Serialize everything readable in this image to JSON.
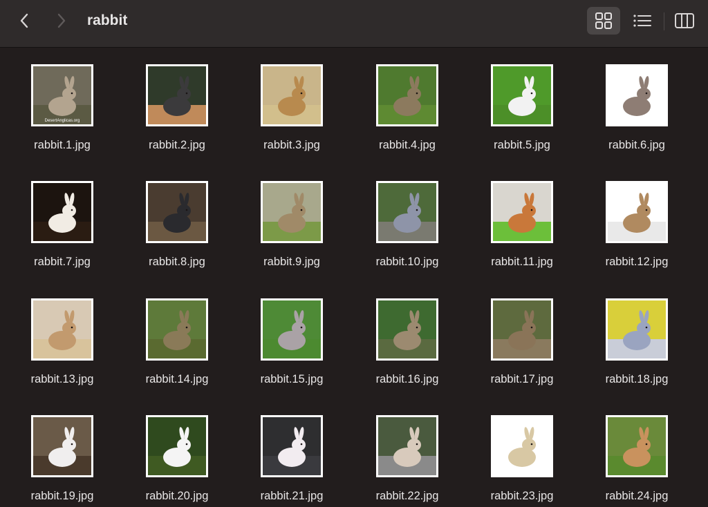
{
  "window": {
    "title": "rabbit"
  },
  "toolbar": {
    "back_icon": "chevron-left-icon",
    "forward_icon": "chevron-right-icon",
    "view_modes": [
      {
        "name": "icons",
        "icon": "grid-icon",
        "selected": true
      },
      {
        "name": "list",
        "icon": "list-icon",
        "selected": false
      },
      {
        "name": "columns",
        "icon": "columns-icon",
        "selected": false
      }
    ]
  },
  "colors": {
    "background": "#221d1d",
    "toolbar": "#2f2b2b",
    "selected_view": "#4a4646",
    "text": "#e8e6e6"
  },
  "files": [
    {
      "name": "rabbit.1.jpg",
      "bg": "#6f6a5a",
      "fg": "#b3a48f",
      "ground": "#5b5a43",
      "watermark": "DesertAnglicas.org"
    },
    {
      "name": "rabbit.2.jpg",
      "bg": "#2f3a2a",
      "fg": "#3b3a3c",
      "ground": "#c08a5a"
    },
    {
      "name": "rabbit.3.jpg",
      "bg": "#c9b58a",
      "fg": "#b88a4e",
      "ground": "#d2bf8c"
    },
    {
      "name": "rabbit.4.jpg",
      "bg": "#4f7a2f",
      "fg": "#8c7a5e",
      "ground": "#5e8a32"
    },
    {
      "name": "rabbit.5.jpg",
      "bg": "#4f9a2a",
      "fg": "#f2f2f2",
      "ground": "#4c8f28"
    },
    {
      "name": "rabbit.6.jpg",
      "bg": "#ffffff",
      "fg": "#8e7d74",
      "ground": "#ffffff"
    },
    {
      "name": "rabbit.7.jpg",
      "bg": "#1c140f",
      "fg": "#f1ece4",
      "ground": "#2a1c12"
    },
    {
      "name": "rabbit.8.jpg",
      "bg": "#4a3c30",
      "fg": "#2a2a2e",
      "ground": "#6b5842"
    },
    {
      "name": "rabbit.9.jpg",
      "bg": "#a8a88c",
      "fg": "#a08a68",
      "ground": "#7c9a48"
    },
    {
      "name": "rabbit.10.jpg",
      "bg": "#4e6a3a",
      "fg": "#8e94a8",
      "ground": "#7a7a70"
    },
    {
      "name": "rabbit.11.jpg",
      "bg": "#d9d6cf",
      "fg": "#c9783a",
      "ground": "#6cbf3a"
    },
    {
      "name": "rabbit.12.jpg",
      "bg": "#ffffff",
      "fg": "#b08a60",
      "ground": "#e9e9e9"
    },
    {
      "name": "rabbit.13.jpg",
      "bg": "#d8c9b4",
      "fg": "#c29a6e",
      "ground": "#d8c39c"
    },
    {
      "name": "rabbit.14.jpg",
      "bg": "#5e7a3a",
      "fg": "#8a7a58",
      "ground": "#5a6a30"
    },
    {
      "name": "rabbit.15.jpg",
      "bg": "#4e8a36",
      "fg": "#aaa2a6",
      "ground": "#4c8a30"
    },
    {
      "name": "rabbit.16.jpg",
      "bg": "#3e6a30",
      "fg": "#9c8a70",
      "ground": "#5a6a40"
    },
    {
      "name": "rabbit.17.jpg",
      "bg": "#5e6a3e",
      "fg": "#8a7458",
      "ground": "#8a7a5e"
    },
    {
      "name": "rabbit.18.jpg",
      "bg": "#d9cf3a",
      "fg": "#9aa4c0",
      "ground": "#c9cdd8"
    },
    {
      "name": "rabbit.19.jpg",
      "bg": "#6a5a48",
      "fg": "#f0eeee",
      "ground": "#4a3a2c"
    },
    {
      "name": "rabbit.20.jpg",
      "bg": "#2f4a1e",
      "fg": "#f4f4f4",
      "ground": "#3f5a22"
    },
    {
      "name": "rabbit.21.jpg",
      "bg": "#2e2e30",
      "fg": "#f2ecf0",
      "ground": "#3a3a3e"
    },
    {
      "name": "rabbit.22.jpg",
      "bg": "#4a5a3e",
      "fg": "#d8cabc",
      "ground": "#8a8a8a"
    },
    {
      "name": "rabbit.23.jpg",
      "bg": "#ffffff",
      "fg": "#d8c8a4",
      "ground": "#ffffff"
    },
    {
      "name": "rabbit.24.jpg",
      "bg": "#6a8a3a",
      "fg": "#c9925e",
      "ground": "#5a8a2e"
    }
  ]
}
